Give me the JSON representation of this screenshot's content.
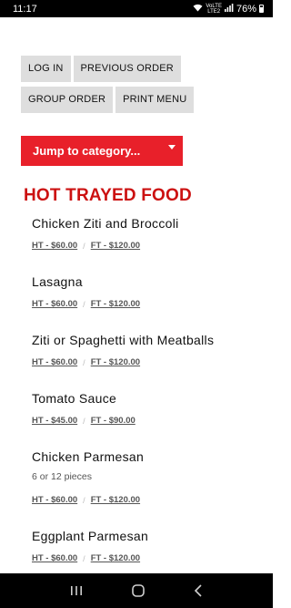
{
  "status_bar": {
    "time": "11:17",
    "volte_top": "VoLTE",
    "volte_bottom": "LTE2",
    "battery": "76%"
  },
  "buttons": {
    "login": "LOG IN",
    "previous_order": "PREVIOUS ORDER",
    "group_order": "GROUP ORDER",
    "print_menu": "PRINT MENU"
  },
  "jump": {
    "label": "Jump to category..."
  },
  "category": {
    "title": "HOT TRAYED FOOD",
    "items": [
      {
        "name": "Chicken Ziti and Broccoli",
        "desc": "",
        "ht": "HT - $60.00",
        "ft": "FT - $120.00"
      },
      {
        "name": "Lasagna",
        "desc": "",
        "ht": "HT - $60.00",
        "ft": "FT - $120.00"
      },
      {
        "name": "Ziti or Spaghetti with Meatballs",
        "desc": "",
        "ht": "HT - $60.00",
        "ft": "FT - $120.00"
      },
      {
        "name": "Tomato Sauce",
        "desc": "",
        "ht": "HT - $45.00",
        "ft": "FT - $90.00"
      },
      {
        "name": "Chicken Parmesan",
        "desc": "6 or 12 pieces",
        "ht": "HT - $60.00",
        "ft": "FT - $120.00"
      },
      {
        "name": "Eggplant Parmesan",
        "desc": "",
        "ht": "HT - $60.00",
        "ft": "FT - $120.00"
      }
    ]
  },
  "price_separator": "/",
  "icons": {
    "wifi": "wifi-icon",
    "signal": "signal-icon",
    "battery": "battery-icon",
    "recents": "recents-icon",
    "home": "home-icon",
    "back": "back-icon"
  }
}
